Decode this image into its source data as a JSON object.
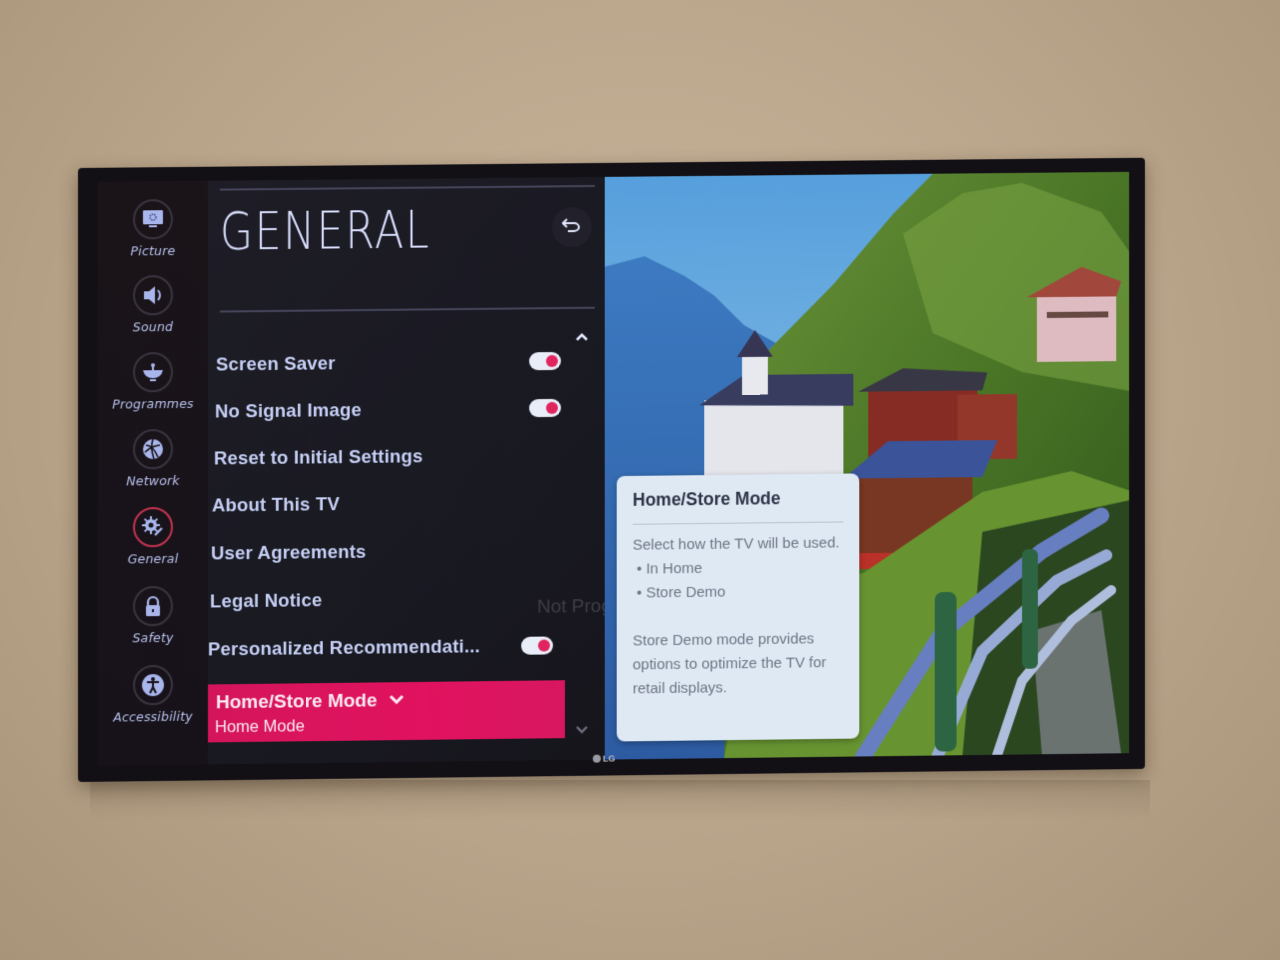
{
  "device": {
    "brand": "LG"
  },
  "sidebar": {
    "items": [
      {
        "label": "Picture",
        "icon": "picture-icon",
        "active": false
      },
      {
        "label": "Sound",
        "icon": "sound-icon",
        "active": false
      },
      {
        "label": "Programmes",
        "icon": "programmes-icon",
        "active": false
      },
      {
        "label": "Network",
        "icon": "network-icon",
        "active": false
      },
      {
        "label": "General",
        "icon": "general-gear-icon",
        "active": true
      },
      {
        "label": "Safety",
        "icon": "lock-icon",
        "active": false
      },
      {
        "label": "Accessibility",
        "icon": "accessibility-icon",
        "active": false
      }
    ]
  },
  "panel": {
    "title": "GENERAL",
    "back_icon": "back-arrow-icon",
    "scroll_up_icon": "chevron-up-icon",
    "scroll_down_icon": "chevron-down-icon",
    "items": [
      {
        "label": "Screen Saver",
        "toggle": true,
        "toggle_on": true
      },
      {
        "label": "No Signal Image",
        "toggle": true,
        "toggle_on": true
      },
      {
        "label": "Reset to Initial Settings",
        "toggle": false
      },
      {
        "label": "About This TV",
        "toggle": false
      },
      {
        "label": "User Agreements",
        "toggle": false
      },
      {
        "label": "Legal Notice",
        "toggle": false
      },
      {
        "label": "Personalized Recommendati...",
        "toggle": true,
        "toggle_on": true
      }
    ],
    "background_ghost_text": "Not Programmed",
    "selected": {
      "label": "Home/Store Mode",
      "value": "Home Mode",
      "icon": "chevron-down-icon"
    }
  },
  "info_card": {
    "title": "Home/Store Mode",
    "intro": "Select how the TV will be used.",
    "options": [
      "• In Home",
      "• Store Demo"
    ],
    "note": "Store Demo mode provides options to optimize the TV for retail displays."
  },
  "colors": {
    "accent": "#e0125f",
    "menu_text": "#c6d0f5",
    "panel_bg": "#1b1a23",
    "card_bg": "#dfe9f4"
  }
}
